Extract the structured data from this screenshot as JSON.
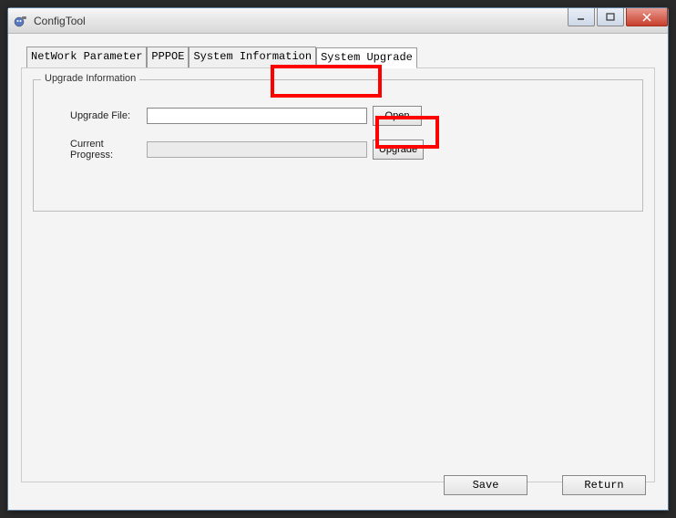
{
  "window": {
    "title": "ConfigTool"
  },
  "tabs": [
    {
      "label": "NetWork Parameter",
      "active": false
    },
    {
      "label": "PPPOE",
      "active": false
    },
    {
      "label": "System Information",
      "active": false
    },
    {
      "label": "System Upgrade",
      "active": true
    }
  ],
  "groupbox": {
    "legend": "Upgrade Information",
    "upgrade_file_label": "Upgrade File:",
    "upgrade_file_value": "",
    "open_button": "Open",
    "progress_label": "Current Progress:",
    "upgrade_button": "Upgrade"
  },
  "buttons": {
    "save": "Save",
    "return": "Return"
  }
}
